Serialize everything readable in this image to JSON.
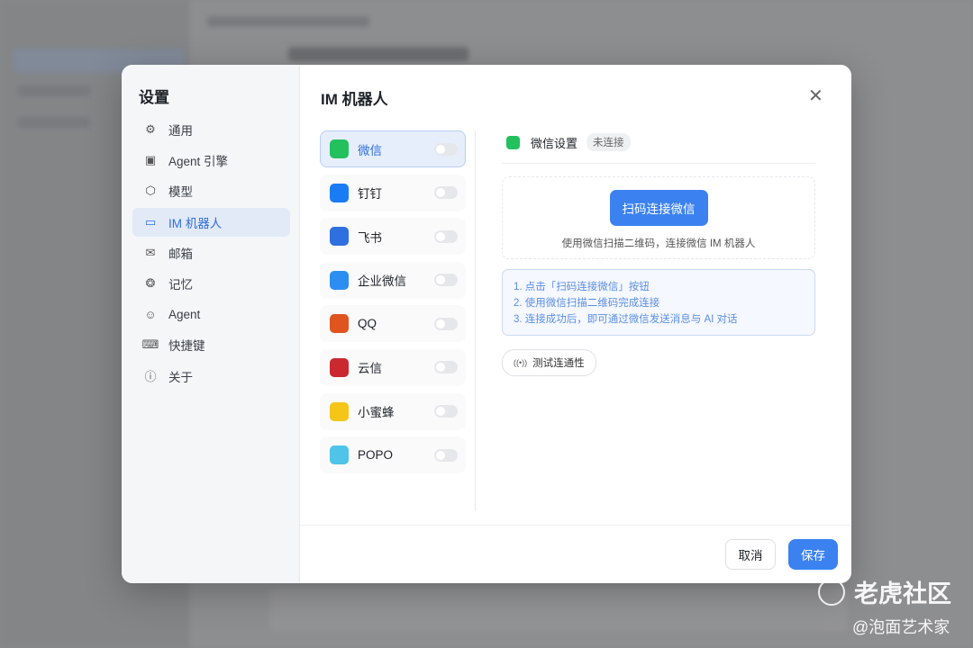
{
  "settings": {
    "title": "设置",
    "nav": [
      {
        "label": "通用",
        "icon": "gear-icon"
      },
      {
        "label": "Agent 引擎",
        "icon": "chip-icon"
      },
      {
        "label": "模型",
        "icon": "cube-icon"
      },
      {
        "label": "IM 机器人",
        "icon": "chat-bubble-icon",
        "active": true
      },
      {
        "label": "邮箱",
        "icon": "mail-icon"
      },
      {
        "label": "记忆",
        "icon": "brain-icon"
      },
      {
        "label": "Agent",
        "icon": "user-circle-icon"
      },
      {
        "label": "快捷键",
        "icon": "keyboard-icon"
      },
      {
        "label": "关于",
        "icon": "info-icon"
      }
    ]
  },
  "page": {
    "title": "IM 机器人"
  },
  "bots": [
    {
      "name": "微信",
      "color": "#22c15e",
      "enabled": false,
      "active": true
    },
    {
      "name": "钉钉",
      "color": "#1a7cf5",
      "enabled": false
    },
    {
      "name": "飞书",
      "color": "#2f6fe0",
      "enabled": false
    },
    {
      "name": "企业微信",
      "color": "#2b8ef0",
      "enabled": false
    },
    {
      "name": "QQ",
      "color": "#e0541f",
      "enabled": false
    },
    {
      "name": "云信",
      "color": "#c9292f",
      "enabled": false
    },
    {
      "name": "小蜜蜂",
      "color": "#f5c518",
      "enabled": false
    },
    {
      "name": "POPO",
      "color": "#4fc3e8",
      "enabled": false
    }
  ],
  "panel": {
    "title": "微信设置",
    "status": "未连接",
    "connect_button": "扫码连接微信",
    "hint": "使用微信扫描二维码，连接微信 IM 机器人",
    "steps": [
      "1. 点击「扫码连接微信」按钮",
      "2. 使用微信扫描二维码完成连接",
      "3. 连接成功后，即可通过微信发送消息与 AI 对话"
    ],
    "test_button": "测试连通性"
  },
  "footer": {
    "cancel": "取消",
    "save": "保存"
  },
  "watermark": {
    "brand": "老虎社区",
    "author": "@泡面艺术家"
  }
}
